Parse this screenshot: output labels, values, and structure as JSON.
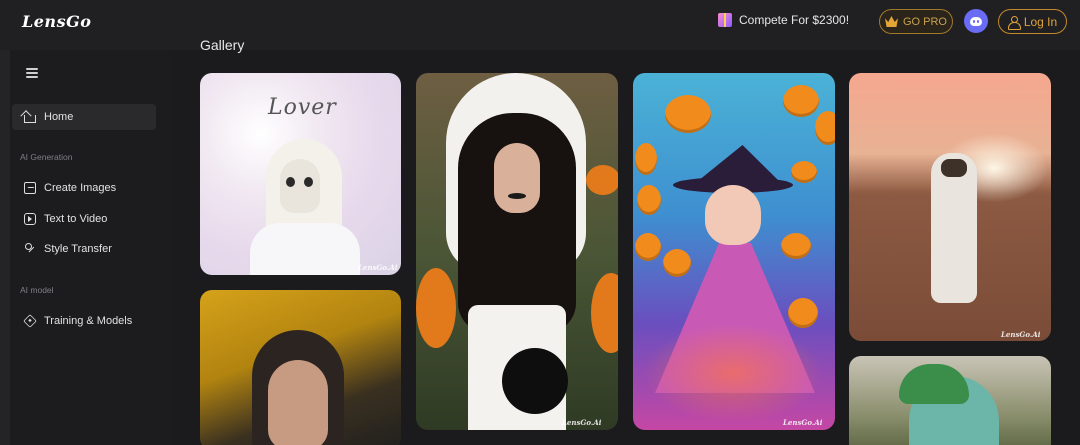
{
  "header": {
    "logo": "LensGo",
    "compete_label": "Compete For $2300!",
    "go_pro_label": "GO PRO",
    "login_label": "Log In"
  },
  "sidebar": {
    "items": [
      {
        "label": "Home",
        "icon": "home-icon",
        "active": true
      },
      {
        "label": "Create Images",
        "icon": "image-icon"
      },
      {
        "label": "Text to Video",
        "icon": "video-icon"
      },
      {
        "label": "Style Transfer",
        "icon": "style-transfer-icon"
      },
      {
        "label": "Training & Models",
        "icon": "training-icon"
      }
    ],
    "sections": {
      "ai_generation": "AI Generation",
      "ai_model": "AI model"
    }
  },
  "main": {
    "title": "Gallery",
    "watermark": "LensGo.Ai",
    "cards": [
      {
        "name": "gallery-card-lover",
        "text": "Lover"
      },
      {
        "name": "gallery-card-portrait"
      },
      {
        "name": "gallery-card-halloween-hood"
      },
      {
        "name": "gallery-card-witch-pumpkins"
      },
      {
        "name": "gallery-card-astronaut"
      },
      {
        "name": "gallery-card-monster"
      }
    ]
  },
  "colors": {
    "background": "#1b1b1d",
    "accent_gold": "#e0a33c",
    "discord": "#6a6cf6"
  }
}
